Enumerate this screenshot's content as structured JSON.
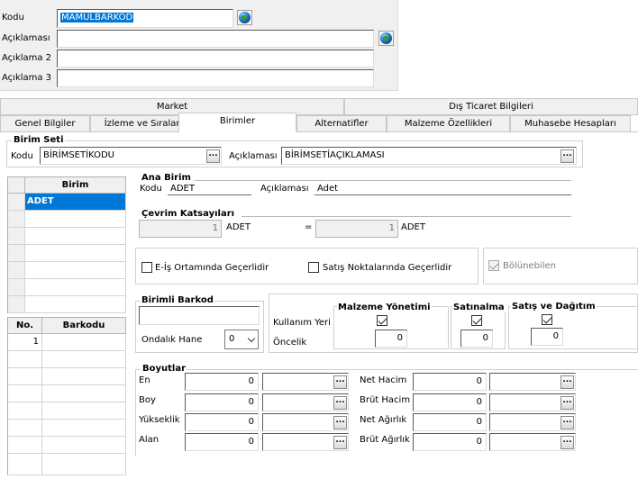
{
  "header": {
    "kodu_label": "Kodu",
    "kodu_value": "MAMULBARKOD",
    "aciklama_label": "Açıklaması",
    "aciklama2_label": "Açıklama 2",
    "aciklama3_label": "Açıklama 3"
  },
  "tabs_top": [
    "Market",
    "Dış Ticaret Bilgileri"
  ],
  "tabs_bottom": [
    "Genel Bilgiler",
    "İzleme ve Sıralama",
    "Birimler",
    "Alternatifler",
    "Malzeme Özellikleri",
    "Muhasebe Hesapları"
  ],
  "birim_seti": {
    "title": "Birim Seti",
    "kodu_label": "Kodu",
    "kodu_value": "BİRİMSETİKODU",
    "aciklama_label": "Açıklaması",
    "aciklama_value": "BİRİMSETİAÇIKLAMASI"
  },
  "birim_grid": {
    "header": "Birim",
    "rows": [
      "ADET"
    ]
  },
  "barkod_grid": {
    "headers": [
      "No.",
      "Barkodu"
    ],
    "rows": [
      "1"
    ]
  },
  "ana_birim": {
    "title": "Ana Birim",
    "kodu_label": "Kodu",
    "kodu_value": "ADET",
    "aciklama_label": "Açıklaması",
    "aciklama_value": "Adet"
  },
  "cevrim": {
    "title": "Çevrim Katsayıları",
    "left_value": "1",
    "left_unit": "ADET",
    "equals": "=",
    "right_value": "1",
    "right_unit": "ADET"
  },
  "checks": {
    "eis_label": "E-İş Ortamında Geçerlidir",
    "satis_label": "Satış Noktalarında Geçerlidir",
    "bolunebilen_label": "Bölünebilen"
  },
  "birimli_barkod": {
    "title": "Birimli Barkod",
    "ondalik_label": "Ondalık Hane",
    "ondalik_value": "0"
  },
  "kullanim": {
    "kullanim_label": "Kullanım Yeri",
    "oncelik_label": "Öncelik",
    "cols": [
      {
        "title": "Malzeme Yönetimi",
        "priority": "0"
      },
      {
        "title": "Satınalma",
        "priority": "0"
      },
      {
        "title": "Satış ve Dağıtım",
        "priority": "0"
      }
    ]
  },
  "boyutlar": {
    "title": "Boyutlar",
    "left": [
      {
        "label": "En",
        "value": "0"
      },
      {
        "label": "Boy",
        "value": "0"
      },
      {
        "label": "Yükseklik",
        "value": "0"
      },
      {
        "label": "Alan",
        "value": "0"
      }
    ],
    "right": [
      {
        "label": "Net Hacim",
        "value": "0"
      },
      {
        "label": "Brüt Hacim",
        "value": "0"
      },
      {
        "label": "Net Ağırlık",
        "value": "0"
      },
      {
        "label": "Brüt Ağırlık",
        "value": "0"
      }
    ]
  },
  "icons": {
    "globe": "globe-icon",
    "ellipsis": "ellipsis-icon"
  },
  "colors": {
    "selection": "#0078d7",
    "panel": "#f0f0f0"
  }
}
